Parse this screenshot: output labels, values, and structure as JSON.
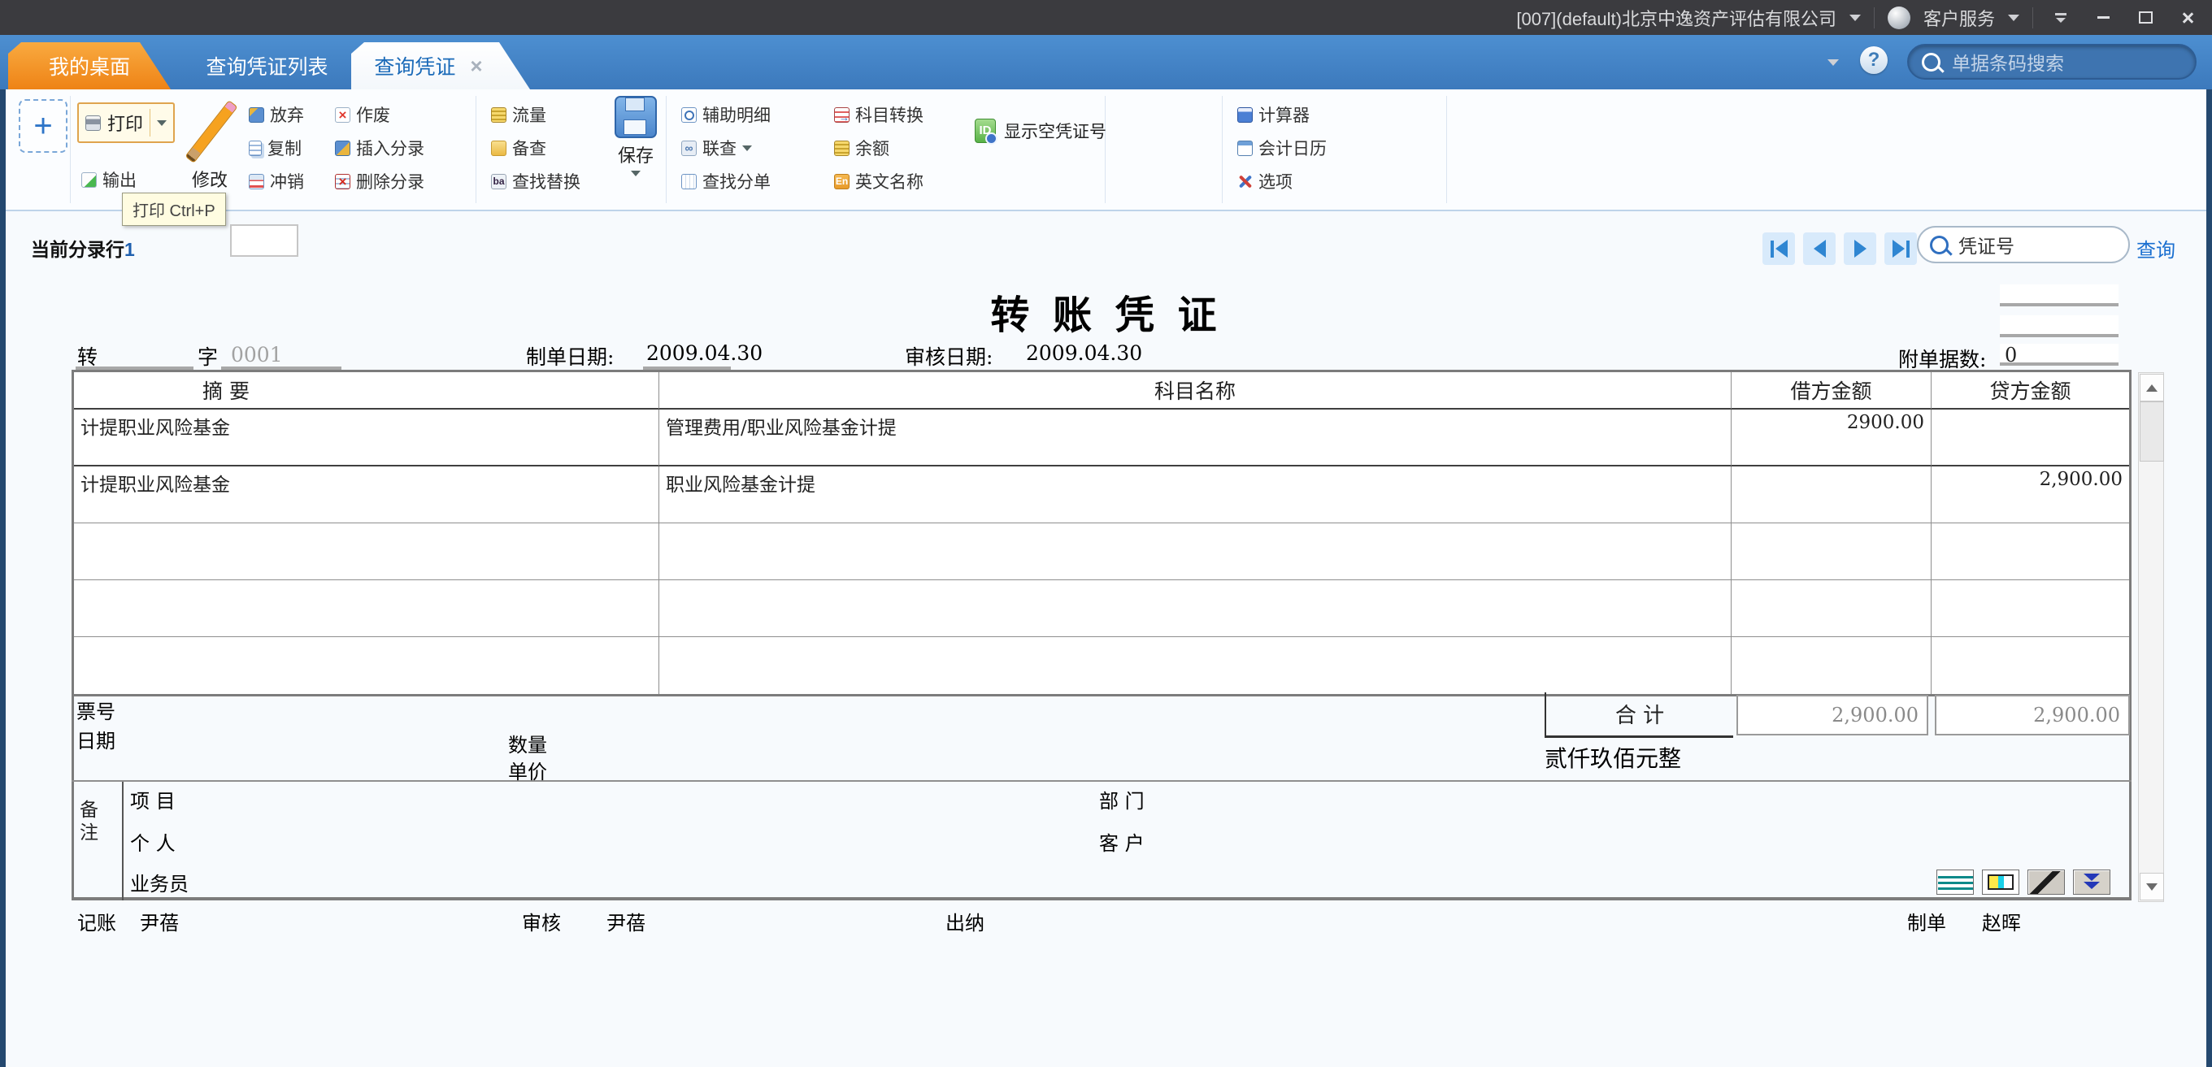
{
  "titlebar": {
    "company": "[007](default)北京中逸资产评估有限公司",
    "service": "客户服务"
  },
  "tabbar": {
    "tabs": {
      "desktop": "我的桌面",
      "voucher_list": "查询凭证列表",
      "voucher_query": "查询凭证"
    },
    "search_placeholder": "单据条码搜索"
  },
  "ribbon": {
    "print": "打印",
    "export": "输出",
    "modify": "修改",
    "abandon": "放弃",
    "copy": "复制",
    "writeoff": "冲销",
    "invalid": "作废",
    "insert_entry": "插入分录",
    "delete_entry": "删除分录",
    "flow": "流量",
    "reference": "备查",
    "find_replace": "查找替换",
    "save": "保存",
    "aux_detail": "辅助明细",
    "link_query": "联查",
    "find_split": "查找分单",
    "subject_convert": "科目转换",
    "balance": "余额",
    "english_name": "英文名称",
    "show_empty_no": "显示空凭证号",
    "calculator": "计算器",
    "calendar": "会计日历",
    "options": "选项",
    "print_tooltip": "打印 Ctrl+P"
  },
  "entry": {
    "label": "当前分录行",
    "value": "1"
  },
  "nav": {
    "search_placeholder": "凭证号",
    "query": "查询"
  },
  "voucher": {
    "title": "转 账 凭 证",
    "word": "转",
    "word_suffix": "字",
    "number": "0001",
    "make_date_label": "制单日期:",
    "make_date": "2009.04.30",
    "audit_date_label": "审核日期:",
    "audit_date": "2009.04.30",
    "attach_label": "附单据数:",
    "attach_count": "0",
    "columns": {
      "summary": "摘 要",
      "account": "科目名称",
      "debit": "借方金额",
      "credit": "贷方金额"
    },
    "rows": [
      {
        "summary": "计提职业风险基金",
        "account": "管理费用/职业风险基金计提",
        "debit": "2900.00",
        "credit": ""
      },
      {
        "summary": "计提职业风险基金",
        "account": "职业风险基金计提",
        "debit": "",
        "credit": "2,900.00"
      },
      {
        "summary": "",
        "account": "",
        "debit": "",
        "credit": ""
      },
      {
        "summary": "",
        "account": "",
        "debit": "",
        "credit": ""
      },
      {
        "summary": "",
        "account": "",
        "debit": "",
        "credit": ""
      }
    ],
    "total_label": "合 计",
    "total_debit": "2,900.00",
    "total_credit": "2,900.00",
    "amount_words": "贰仟玖佰元整",
    "fields": {
      "ticket": "票号",
      "date": "日期",
      "qty": "数量",
      "price": "单价",
      "remark": "备注",
      "project": "项 目",
      "person": "个 人",
      "salesman": "业务员",
      "dept": "部 门",
      "customer": "客 户"
    },
    "signs": {
      "book_label": "记账",
      "book": "尹蓓",
      "audit_label": "审核",
      "audit": "尹蓓",
      "cashier_label": "出纳",
      "cashier": "",
      "maker_label": "制单",
      "maker": "赵晖"
    }
  }
}
